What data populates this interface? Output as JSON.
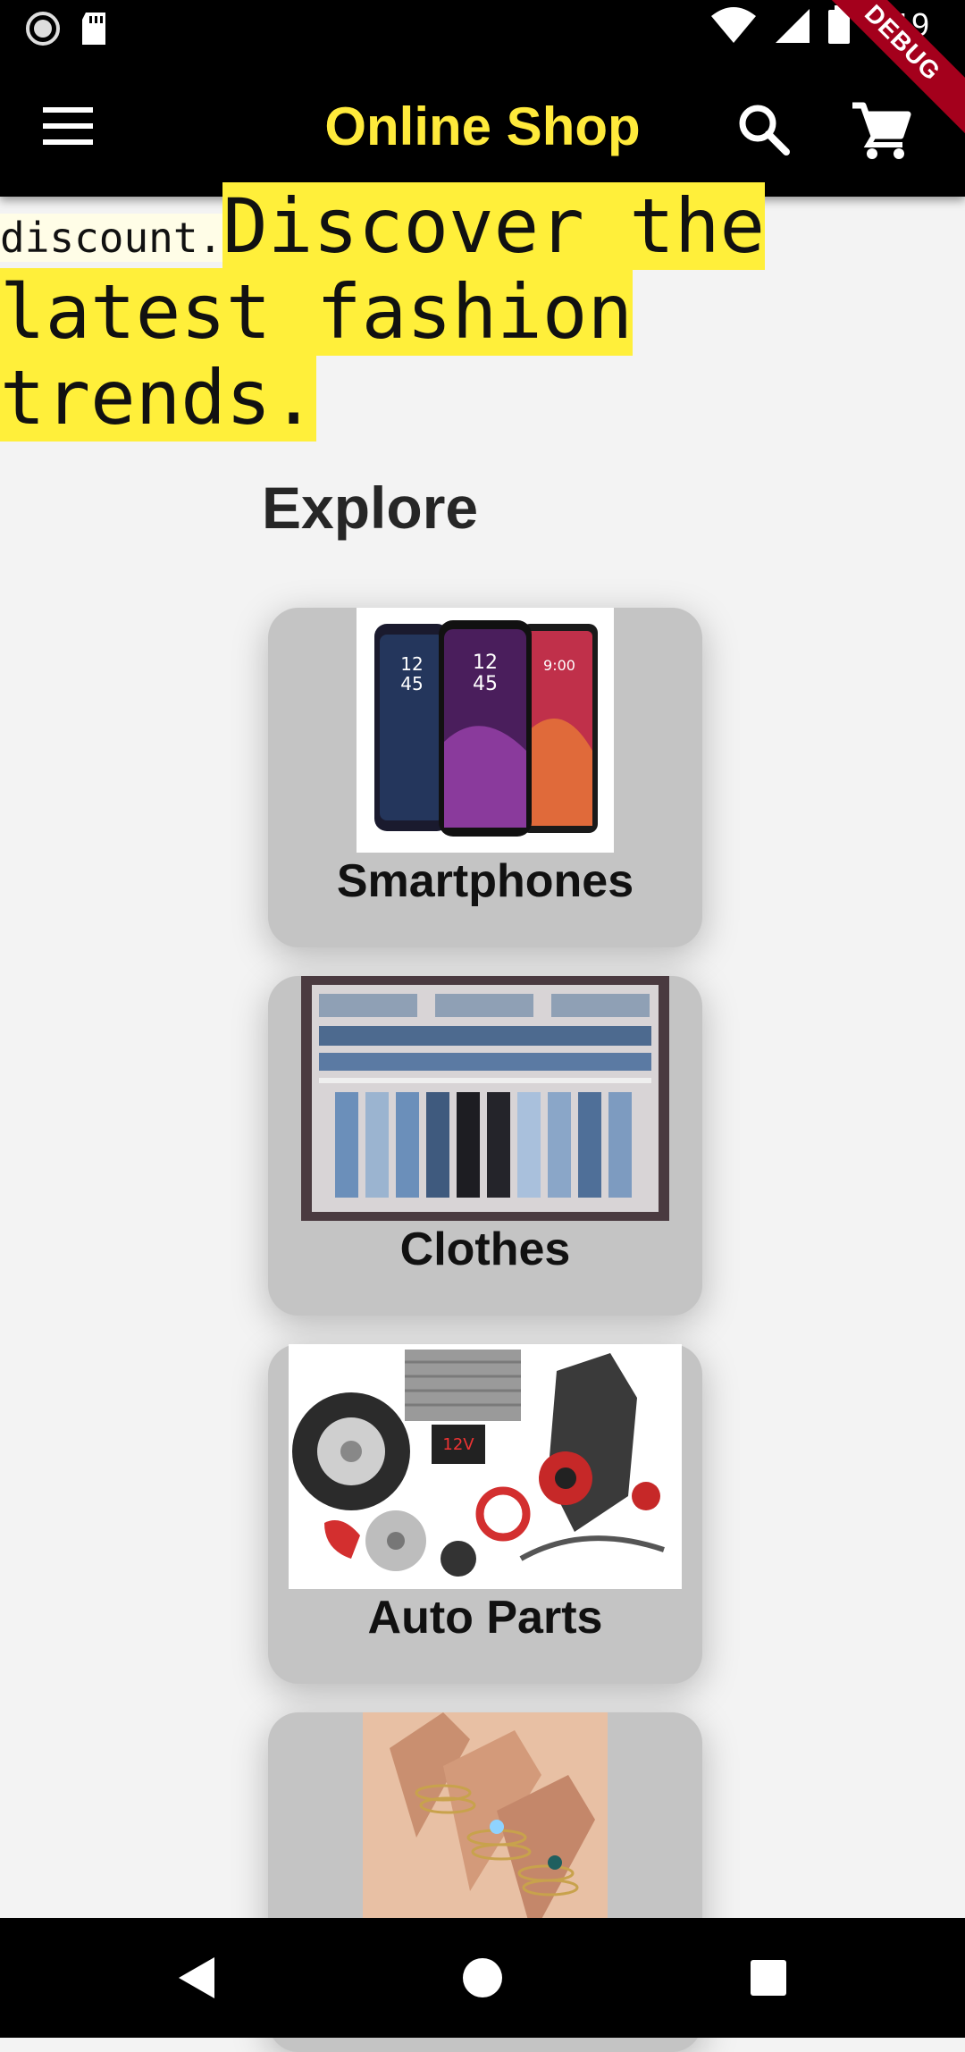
{
  "status_bar": {
    "time": "8:19",
    "icons": [
      "record-icon",
      "sd-card-icon",
      "wifi-icon",
      "cell-signal-icon",
      "battery-icon"
    ]
  },
  "app_bar": {
    "title": "Online Shop",
    "menu_icon": "menu-icon",
    "search_icon": "search-icon",
    "cart_icon": "shopping-cart-icon",
    "debug_label": "DEBUG",
    "title_color": "#ffea3b",
    "background": "#000000"
  },
  "promo": {
    "small_text": "discount.",
    "large_text": "Discover the latest fashion trends.",
    "highlight_color": "#ffef3a"
  },
  "explore": {
    "title": "Explore",
    "categories": [
      {
        "label": "Smartphones",
        "image": "smartphones-image"
      },
      {
        "label": "Clothes",
        "image": "jeans-rack-image"
      },
      {
        "label": "Auto Parts",
        "image": "auto-parts-image"
      },
      {
        "label": "",
        "image": "rings-jewelry-image"
      }
    ]
  },
  "nav_bar": {
    "icons": [
      "back-icon",
      "home-icon",
      "recents-icon"
    ]
  }
}
